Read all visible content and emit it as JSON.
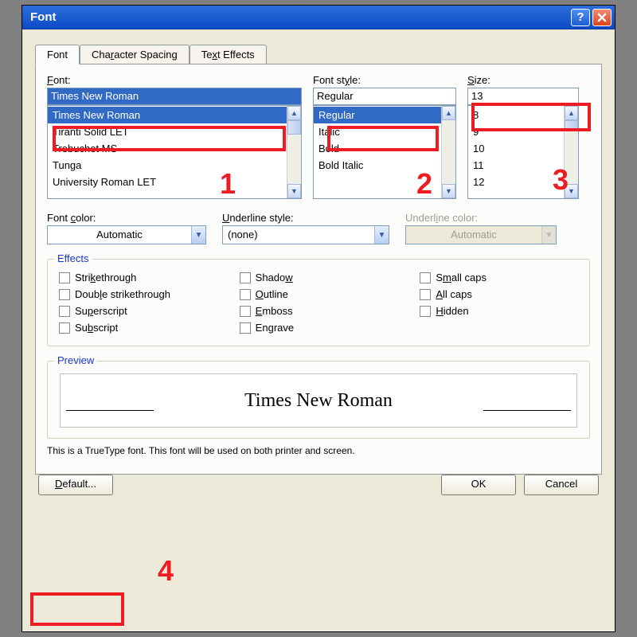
{
  "window": {
    "title": "Font"
  },
  "tabs": {
    "font": "Font",
    "spacing_pre": "Cha",
    "spacing_ul": "r",
    "spacing_post": "acter Spacing",
    "effects_pre": "Te",
    "effects_ul": "x",
    "effects_post": "t Effects"
  },
  "labels": {
    "font_ul": "F",
    "font_post": "ont:",
    "style_pre": "Font st",
    "style_ul": "y",
    "style_post": "le:",
    "size_ul": "S",
    "size_post": "ize:",
    "color_pre": "Font ",
    "color_ul": "c",
    "color_post": "olor:",
    "ustyle_ul": "U",
    "ustyle_post": "nderline style:",
    "ucolor_pre": "Underl",
    "ucolor_ul": "i",
    "ucolor_post": "ne color:",
    "effects_title": "Effects",
    "preview_title": "Preview"
  },
  "font": {
    "value": "Times New Roman",
    "items": [
      "Times New Roman",
      "Tiranti Solid LET",
      "Trebuchet MS",
      "Tunga",
      "University Roman LET"
    ]
  },
  "style": {
    "value": "Regular",
    "items": [
      "Regular",
      "Italic",
      "Bold",
      "Bold Italic"
    ]
  },
  "size": {
    "value": "13",
    "items": [
      "8",
      "9",
      "10",
      "11",
      "12"
    ]
  },
  "combos": {
    "color": "Automatic",
    "ustyle": "(none)",
    "ucolor": "Automatic"
  },
  "effects": {
    "c1": [
      {
        "ul": "",
        "pre": "Stri",
        "u": "k",
        "post": "ethrough"
      },
      {
        "ul": "",
        "pre": "Doub",
        "u": "l",
        "post": "e strikethrough"
      },
      {
        "ul": "",
        "pre": "Su",
        "u": "p",
        "post": "erscript"
      },
      {
        "ul": "",
        "pre": "Su",
        "u": "b",
        "post": "script"
      }
    ],
    "c2": [
      {
        "pre": "Shado",
        "u": "w",
        "post": ""
      },
      {
        "pre": "",
        "u": "O",
        "post": "utline"
      },
      {
        "pre": "",
        "u": "E",
        "post": "mboss"
      },
      {
        "pre": "En",
        "u": "g",
        "post": "rave"
      }
    ],
    "c3": [
      {
        "pre": "S",
        "u": "m",
        "post": "all caps"
      },
      {
        "pre": "",
        "u": "A",
        "post": "ll caps"
      },
      {
        "pre": "",
        "u": "H",
        "post": "idden"
      }
    ]
  },
  "preview": {
    "text": "Times New Roman",
    "status": "This is a TrueType font. This font will be used on both printer and screen."
  },
  "buttons": {
    "default_ul": "D",
    "default_post": "efault...",
    "ok": "OK",
    "cancel": "Cancel"
  },
  "annotations": {
    "n1": "1",
    "n2": "2",
    "n3": "3",
    "n4": "4"
  }
}
